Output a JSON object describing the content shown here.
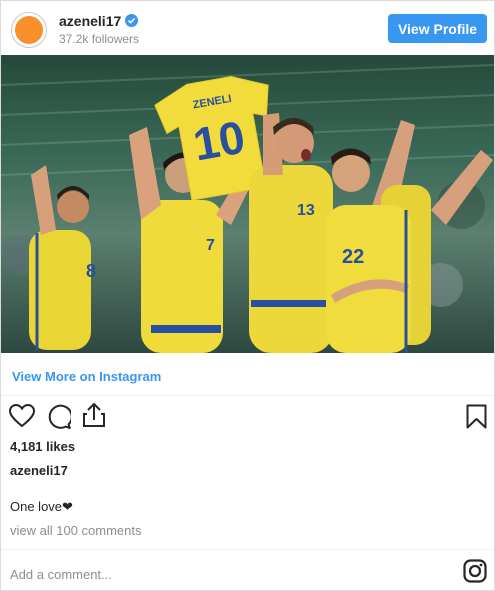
{
  "header": {
    "username": "azeneli17",
    "followers": "37.2k followers",
    "verified_icon": "verified-badge-icon",
    "view_profile_label": "View Profile",
    "avatar_color": "#f7902b"
  },
  "photo": {
    "shirt_name": "ZENELI",
    "shirt_number": "10",
    "player_numbers": [
      "8",
      "7",
      "13",
      "22"
    ]
  },
  "links": {
    "view_more": "View More on Instagram"
  },
  "actions": {
    "icons": [
      "heart-icon",
      "comment-icon",
      "share-icon",
      "bookmark-icon"
    ]
  },
  "post": {
    "likes": "4,181 likes",
    "author": "azeneli17",
    "caption": "One love❤",
    "view_comments": "view all 100 comments"
  },
  "comment_box": {
    "placeholder": "Add a comment..."
  },
  "colors": {
    "accent": "#3897f0",
    "kit_yellow": "#f2dc3c",
    "kit_blue": "#2a4f9e"
  }
}
